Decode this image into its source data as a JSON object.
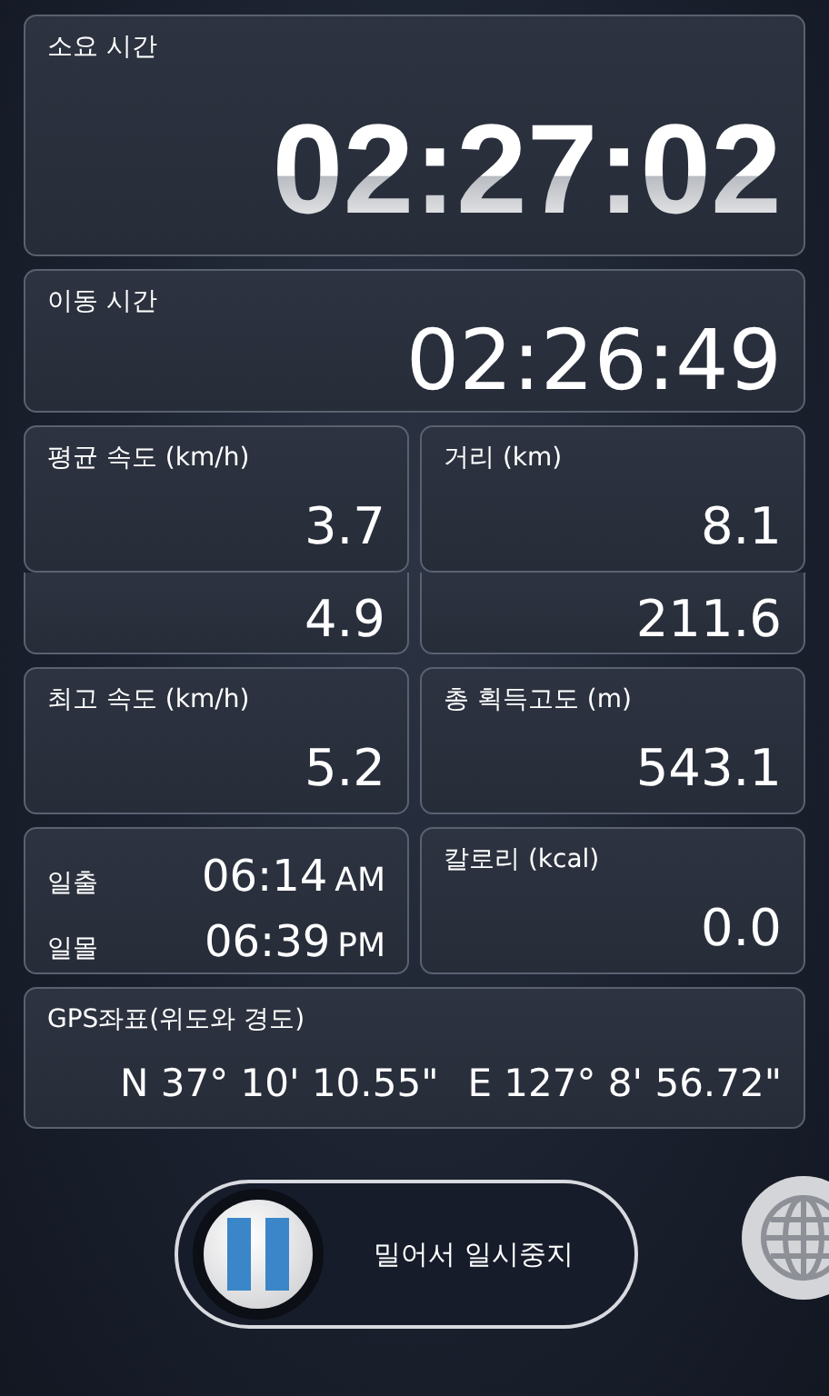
{
  "total_time": {
    "label": "소요 시간",
    "value": "02:27:02"
  },
  "moving_time": {
    "label": "이동 시간",
    "value": "02:26:49"
  },
  "stat_rows": [
    {
      "kind": "labeled",
      "cells": [
        {
          "label": "평균 속도 (km/h)",
          "value": "3.7"
        },
        {
          "label": "거리 (km)",
          "value": "8.1"
        }
      ]
    },
    {
      "kind": "values",
      "cells": [
        {
          "value": "4.9"
        },
        {
          "value": "211.6"
        }
      ]
    },
    {
      "kind": "labeled",
      "cells": [
        {
          "label": "최고 속도 (km/h)",
          "value": "5.2"
        },
        {
          "label": "총 획득고도 (m)",
          "value": "543.1"
        }
      ]
    }
  ],
  "sun": [
    {
      "label": "일출",
      "time": "06:14",
      "ampm": "AM"
    },
    {
      "label": "일몰",
      "time": "06:39",
      "ampm": "PM"
    }
  ],
  "calories": {
    "label": "칼로리 (kcal)",
    "value": "0.0"
  },
  "gps": {
    "label": "GPS좌표(위도와 경도)",
    "latitude": "N 37° 10' 10.55\"",
    "longitude": "E 127° 8' 56.72\""
  },
  "slider": {
    "label": "밀어서 일시중지",
    "level": 0
  }
}
